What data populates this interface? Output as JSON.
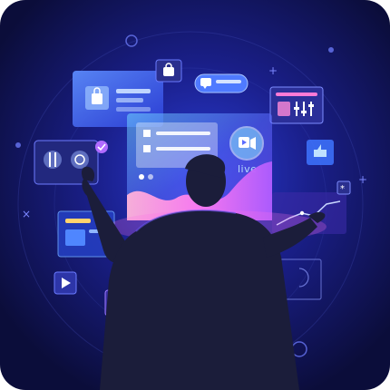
{
  "panel": {
    "live_label": "live"
  },
  "colors": {
    "bg_outer": "#0b0d3a",
    "bg_glow": "#2a3bd6",
    "panel_blue": "#3b6dff",
    "panel_cyan": "#43d2ff",
    "panel_pink": "#ff5fe1",
    "panel_purple": "#7c48ff",
    "silhouette": "#1b1d3a"
  },
  "icons": [
    "shopping-bag-icon",
    "chat-bubble-icon",
    "video-play-icon",
    "checkmark-icon",
    "tools-icon",
    "pointer-hand-icon",
    "like-thumb-icon",
    "snowflake-icon",
    "play-icon",
    "delivery-truck-icon",
    "slider-controls-icon",
    "fingerprint-icon"
  ]
}
